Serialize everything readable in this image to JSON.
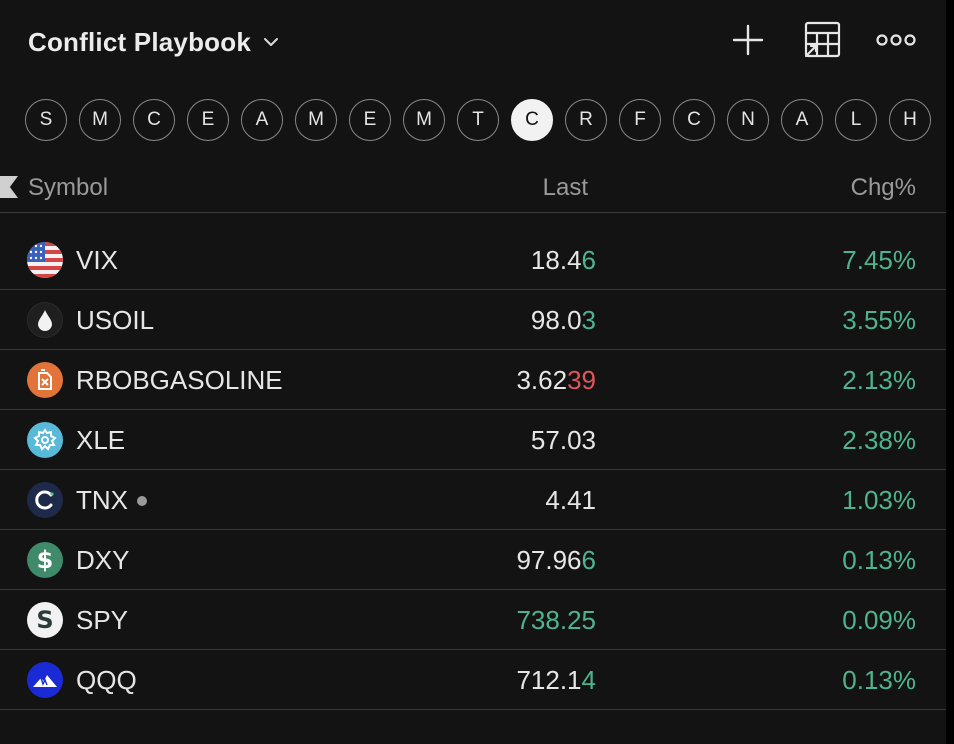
{
  "watchlist": {
    "title": "Conflict Playbook"
  },
  "toolbar": {
    "add_icon": "plus-icon",
    "layout_icon": "table-layout-icon",
    "more_icon": "more-icon"
  },
  "filter_chips": [
    {
      "label": "S"
    },
    {
      "label": "M"
    },
    {
      "label": "C"
    },
    {
      "label": "E"
    },
    {
      "label": "A"
    },
    {
      "label": "M"
    },
    {
      "label": "E"
    },
    {
      "label": "M"
    },
    {
      "label": "T"
    },
    {
      "label": "C",
      "active": true
    },
    {
      "label": "R"
    },
    {
      "label": "F"
    },
    {
      "label": "C"
    },
    {
      "label": "N"
    },
    {
      "label": "A"
    },
    {
      "label": "L"
    },
    {
      "label": "H"
    }
  ],
  "columns": {
    "symbol": "Symbol",
    "last": "Last",
    "change_pct": "Chg%"
  },
  "rows": [
    {
      "symbol": "VIX",
      "icon": "us-flag-icon",
      "last_base": "18.4",
      "last_tick": "6",
      "tick_dir": "up",
      "chg": "7.45%"
    },
    {
      "symbol": "USOIL",
      "icon": "oil-drop-icon",
      "last_base": "98.0",
      "last_tick": "3",
      "tick_dir": "up",
      "chg": "3.55%"
    },
    {
      "symbol": "RBOBGASOLINE",
      "icon": "fuel-can-icon",
      "last_base": "3.62",
      "last_tick": "39",
      "tick_dir": "down",
      "chg": "2.13%"
    },
    {
      "symbol": "XLE",
      "icon": "gear-badge-icon",
      "last_base": "57.03",
      "last_tick": "",
      "tick_dir": "none",
      "chg": "2.38%"
    },
    {
      "symbol": "TNX",
      "icon": "cboe-c-icon",
      "last_base": "4.41",
      "last_tick": "",
      "tick_dir": "none",
      "chg": "1.03%",
      "dot": true
    },
    {
      "symbol": "DXY",
      "icon": "dollar-icon",
      "last_base": "97.96",
      "last_tick": "6",
      "tick_dir": "up",
      "chg": "0.13%"
    },
    {
      "symbol": "SPY",
      "icon": "spdr-s-icon",
      "last_base": "",
      "last_tick": "738.25",
      "tick_dir": "up",
      "chg": "0.09%"
    },
    {
      "symbol": "QQQ",
      "icon": "invesco-mountain-icon",
      "last_base": "712.1",
      "last_tick": "4",
      "tick_dir": "up",
      "chg": "0.13%"
    }
  ],
  "colors": {
    "up": "#4fb48e",
    "down": "#e0555a",
    "background": "#131313"
  }
}
